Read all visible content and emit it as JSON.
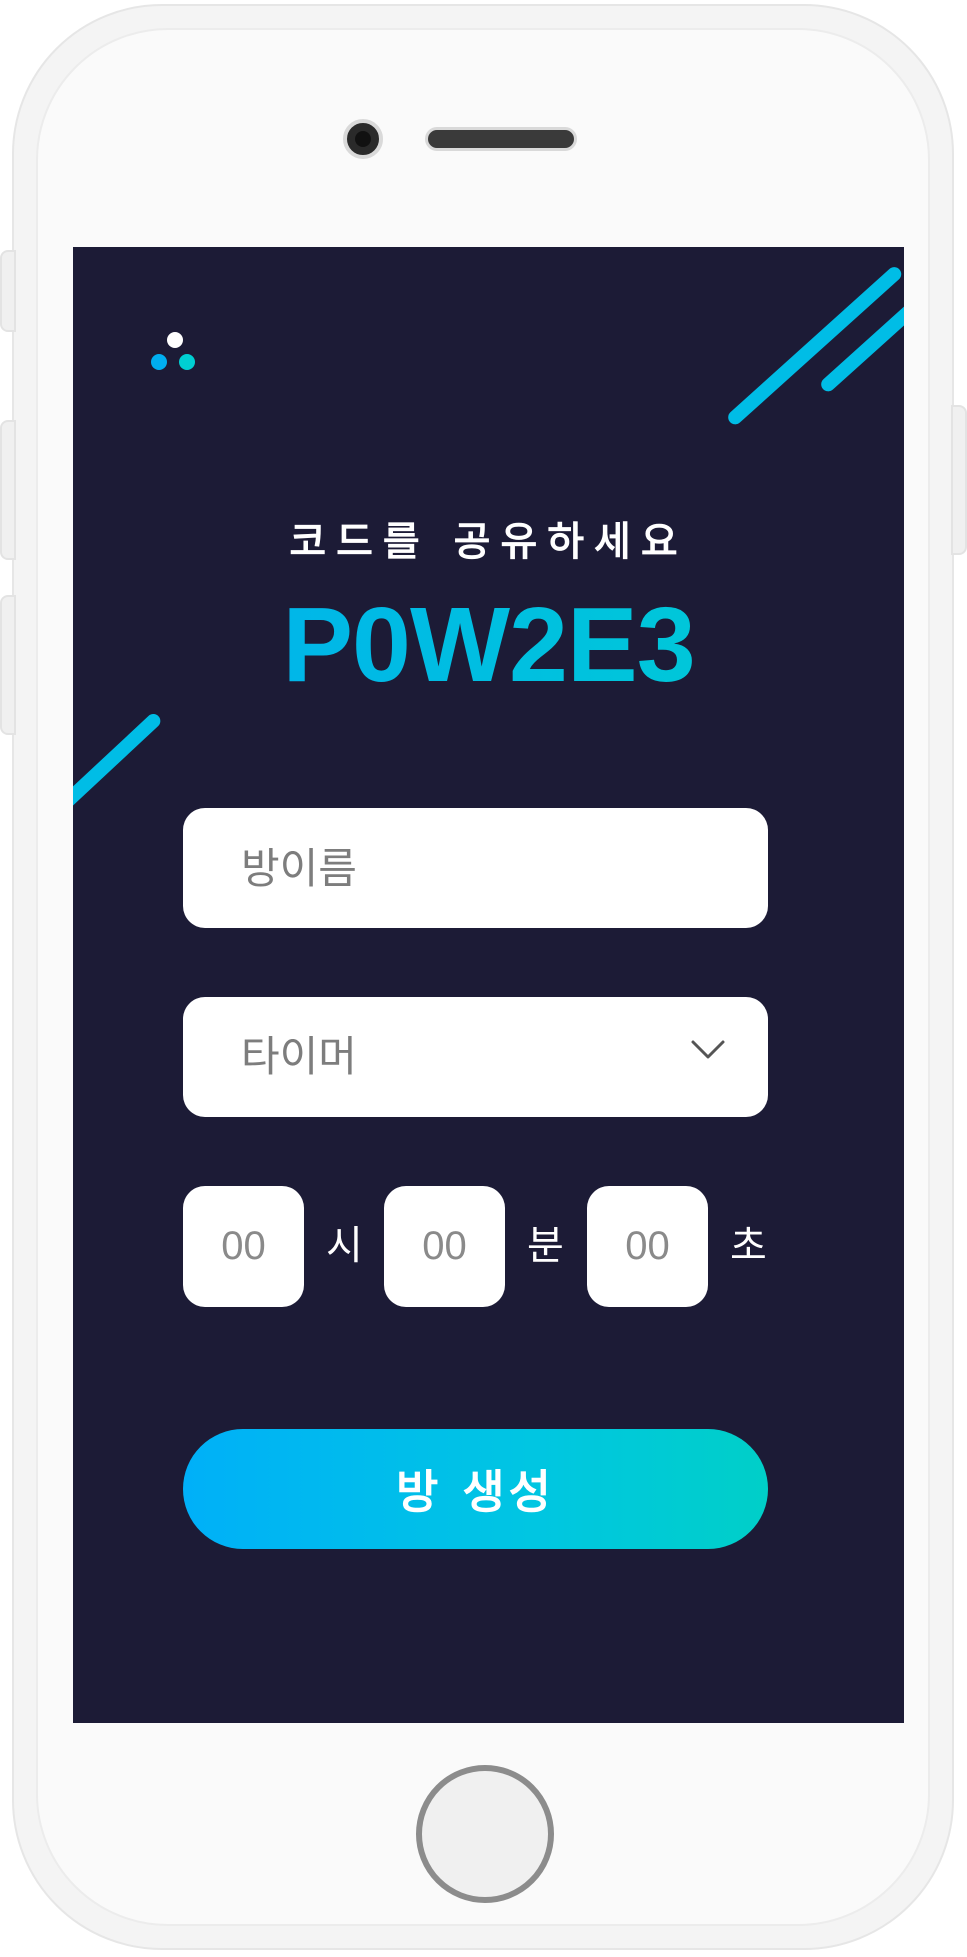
{
  "screen": {
    "background_color": "#1c1b36",
    "accent_color": "#00bde6"
  },
  "logo": {
    "icon": "three-dots-logo-icon",
    "dot_colors": [
      "#ffffff",
      "#00aef0",
      "#00cfd2"
    ]
  },
  "header": {
    "share_prompt": "코드를 공유하세요",
    "room_code": "P0W2E3"
  },
  "form": {
    "room_name_placeholder": "방이름",
    "timer_select": {
      "selected_label": "타이머",
      "icon": "chevron-down-icon"
    },
    "time": {
      "hours_placeholder": "00",
      "hours_unit": "시",
      "minutes_placeholder": "00",
      "minutes_unit": "분",
      "seconds_placeholder": "00",
      "seconds_unit": "초"
    },
    "create_button_label": "방 생성"
  },
  "device": {
    "home_button_icon": "home-button-icon"
  }
}
